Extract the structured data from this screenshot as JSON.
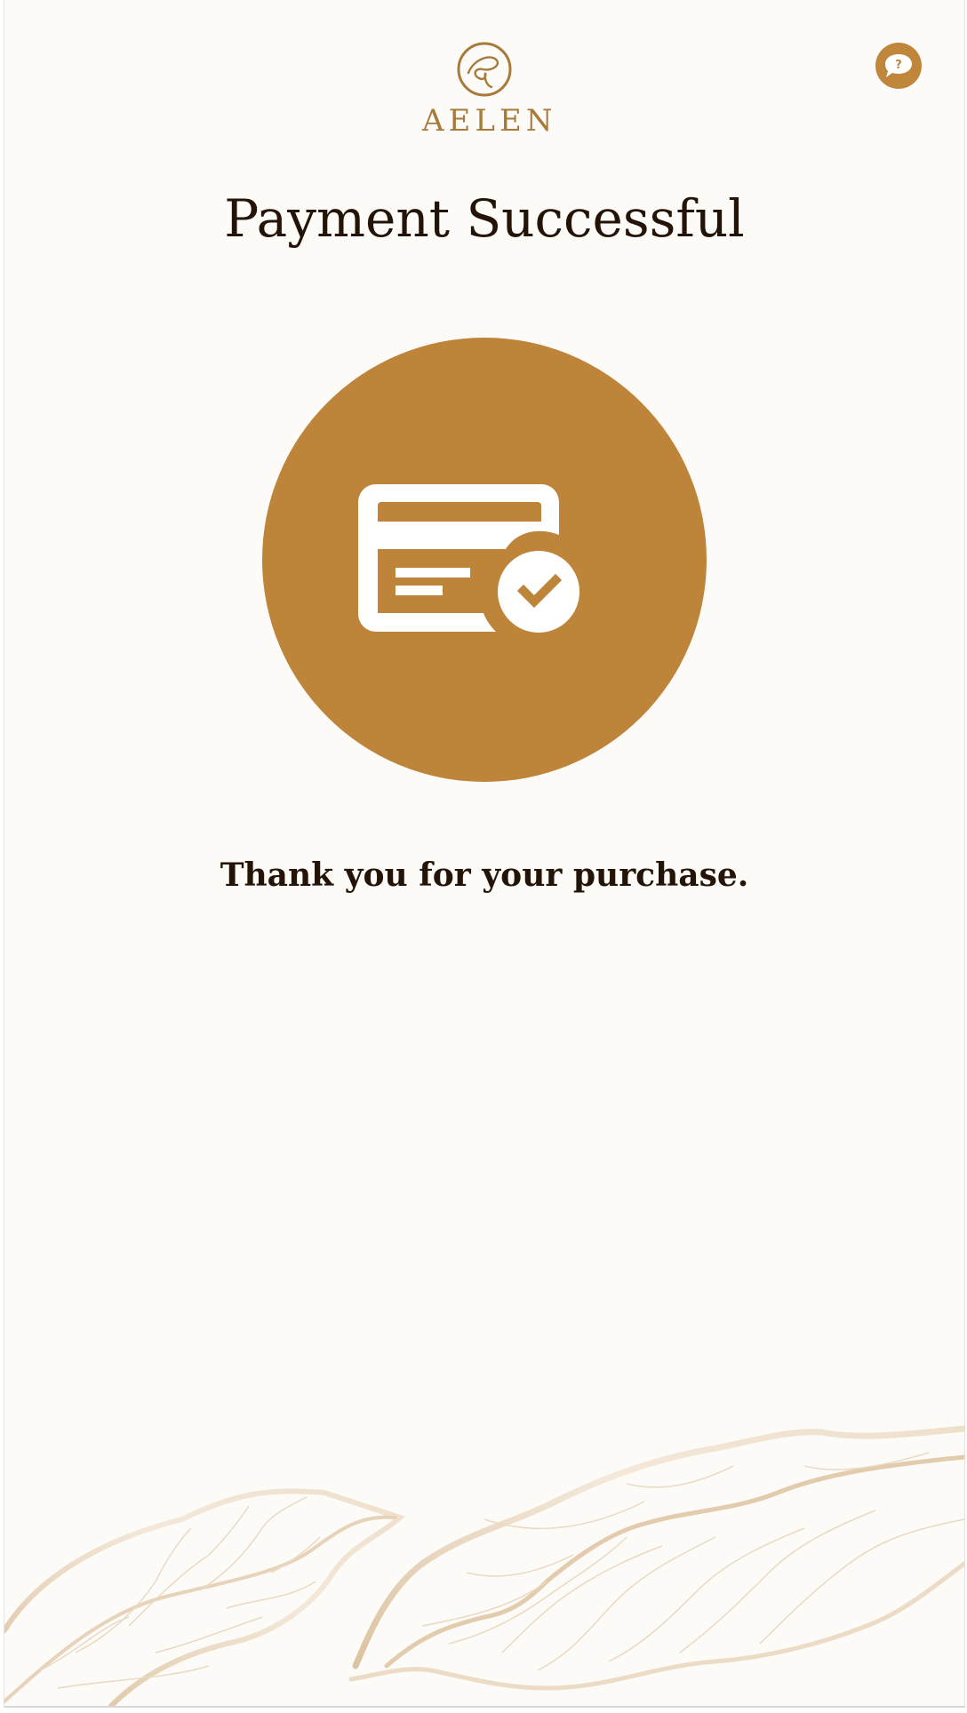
{
  "brand": {
    "name": "AELEN"
  },
  "header": {
    "help_icon": "help-chat-bubble-icon",
    "help_symbol": "?"
  },
  "main": {
    "title": "Payment Successful",
    "icon": "credit-card-check-icon",
    "message": "Thank you for your purchase."
  },
  "colors": {
    "accent": "#bd843a",
    "text": "#241307",
    "background": "#fcfbf8",
    "leaf": "#dcc3a1"
  }
}
